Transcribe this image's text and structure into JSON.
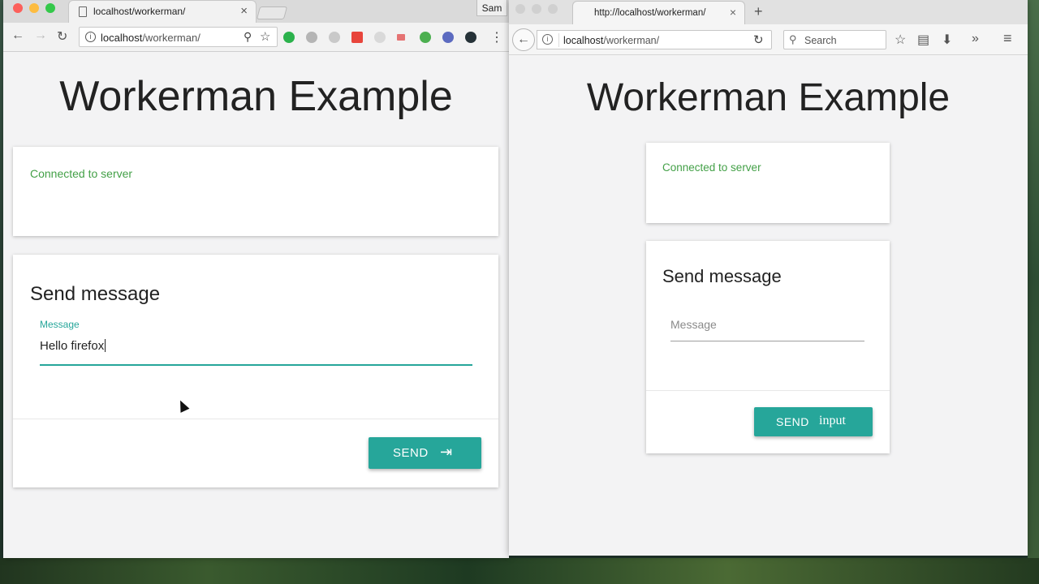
{
  "chrome": {
    "tab_title": "localhost/workerman/",
    "tab_close": "×",
    "profile": "Sam",
    "nav": {
      "back": "←",
      "forward": "→",
      "reload": "↻",
      "menu": "⋮"
    },
    "address": {
      "host": "localhost",
      "path": "/workerman/",
      "zoom": "⚲",
      "star": "☆",
      "info": "i"
    },
    "extensions": [
      {
        "name": "green-extension-icon",
        "color": "#2bb24c"
      },
      {
        "name": "grey-extension-icon",
        "color": "#b5b5b5"
      },
      {
        "name": "leaf-extension-icon",
        "color": "#c9c9c9"
      },
      {
        "name": "colorful-extension-icon",
        "color": "#e8453c"
      },
      {
        "name": "circle-extension-icon",
        "color": "#d9d9d9"
      },
      {
        "name": "red-extension-icon",
        "color": "#e57373"
      },
      {
        "name": "wave-extension-icon",
        "color": "#4caf50"
      },
      {
        "name": "purple-extension-icon",
        "color": "#5c6bc0"
      },
      {
        "name": "dark-extension-icon",
        "color": "#263238"
      }
    ],
    "page": {
      "heading": "Workerman Example",
      "status": "Connected to server",
      "send_title": "Send message",
      "field_label": "Message",
      "field_value": "Hello firefox",
      "button_label": "SEND",
      "button_icon": "⇥"
    }
  },
  "firefox": {
    "tab_title": "http://localhost/workerman/",
    "tab_close": "×",
    "new_tab": "+",
    "nav": {
      "back": "←",
      "reload": "↻",
      "overflow": "»",
      "menu": "≡"
    },
    "address": {
      "host": "localhost",
      "path": "/workerman/",
      "info": "i"
    },
    "search": {
      "icon": "⚲",
      "placeholder": "Search"
    },
    "toolbar_icons": {
      "bookmark": "☆",
      "reader": "▤",
      "download": "⬇"
    },
    "page": {
      "heading": "Workerman Example",
      "status": "Connected to server",
      "send_title": "Send message",
      "field_placeholder": "Message",
      "button_label": "SEND",
      "button_icon_text": "input"
    }
  },
  "colors": {
    "accent": "#26a69a",
    "status_green": "#43a047"
  }
}
